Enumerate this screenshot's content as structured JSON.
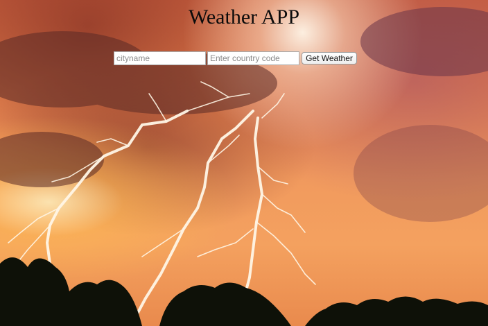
{
  "app": {
    "title": "Weather APP"
  },
  "form": {
    "city_placeholder": "cityname",
    "country_placeholder": "Enter country code",
    "submit_label": "Get Weather"
  },
  "background": {
    "image": "lightning-storm-photo"
  }
}
